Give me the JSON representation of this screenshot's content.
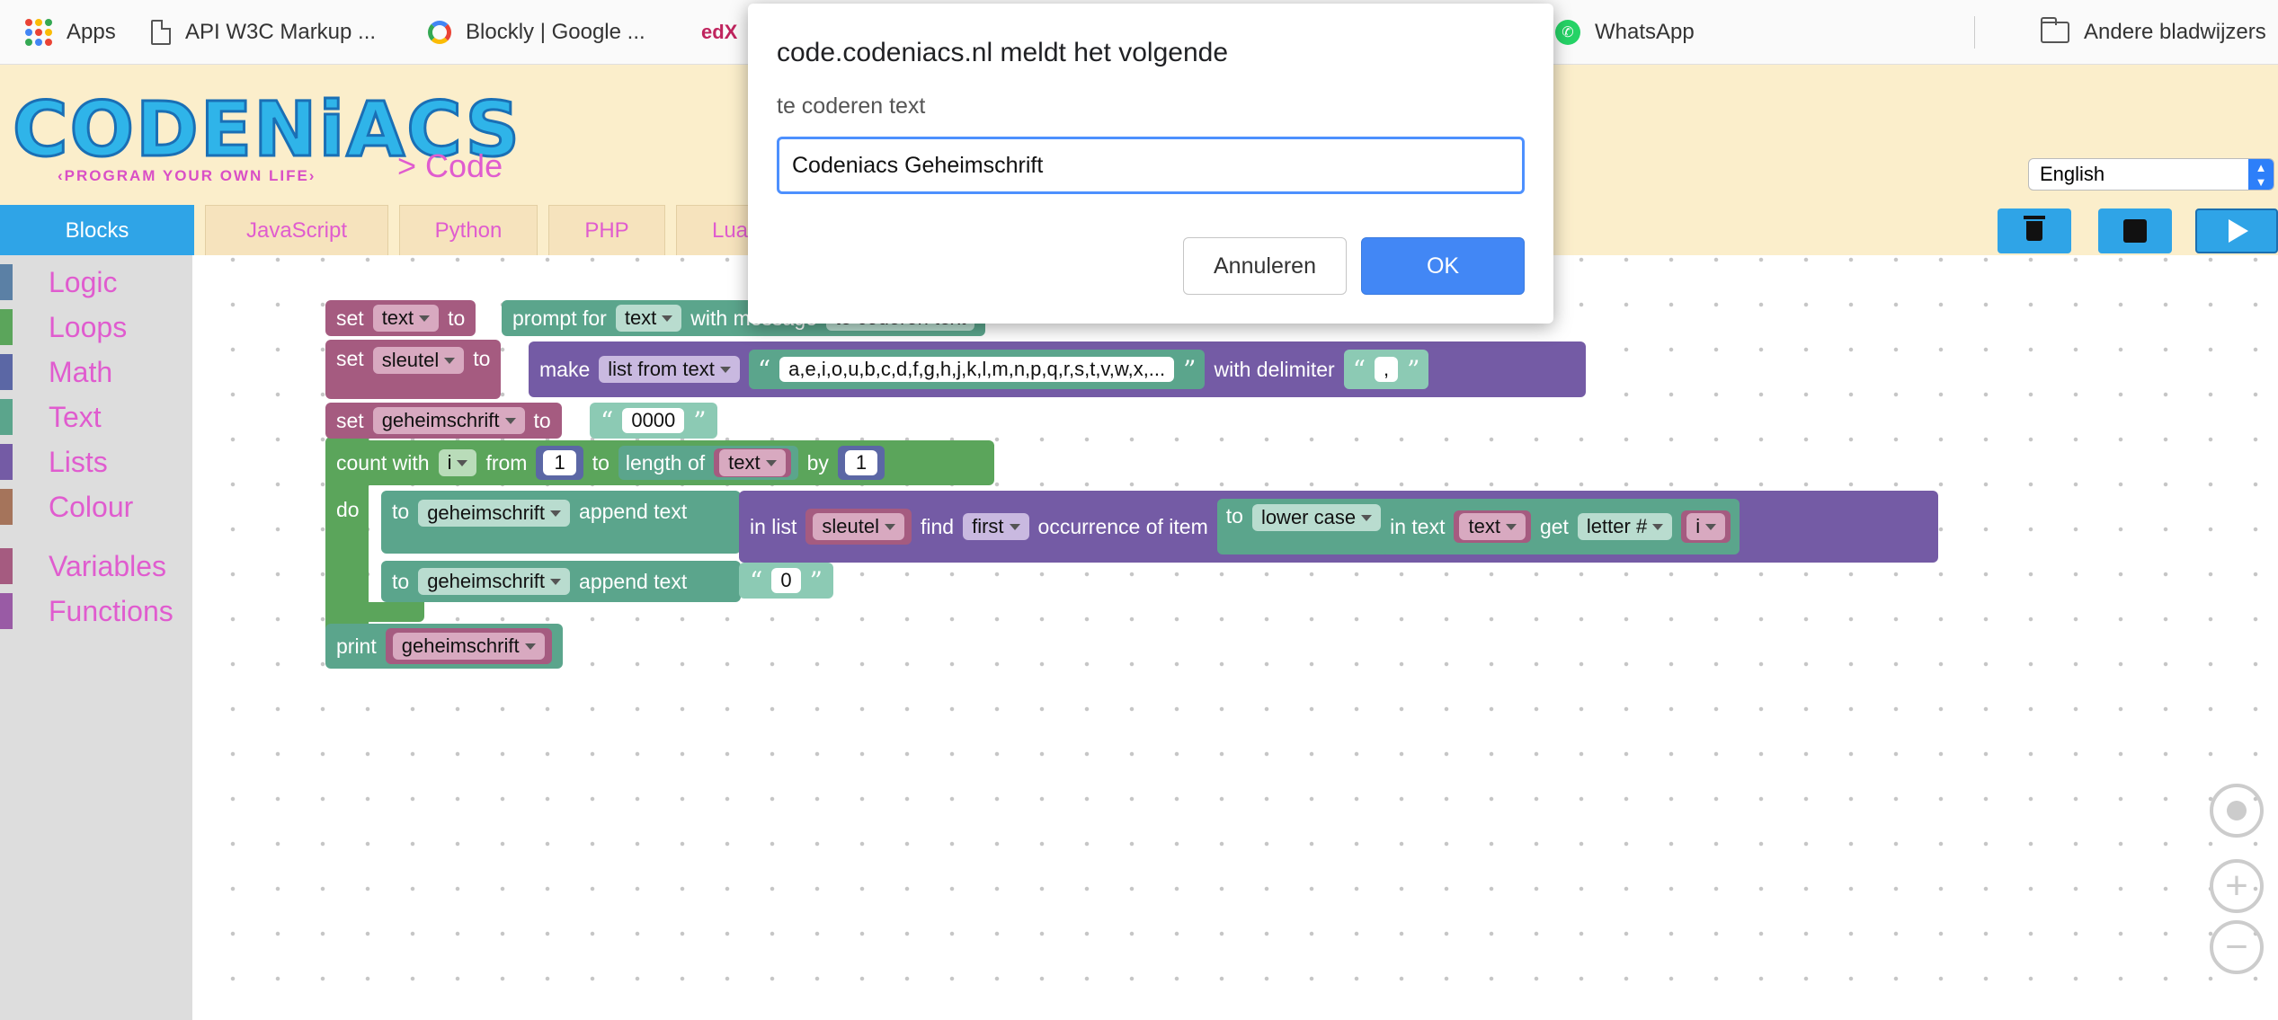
{
  "bookmarks": {
    "apps": "Apps",
    "api": "API W3C Markup ...",
    "blockly": "Blockly  |  Google ...",
    "edx": "edX",
    "whatsapp": "WhatsApp",
    "other": "Andere bladwijzers"
  },
  "header": {
    "logo": "CODENiACS",
    "logo_tagline": "‹PROGRAM YOUR OWN LIFE›",
    "breadcrumb": "> Code",
    "language": "English"
  },
  "tabs": [
    "Blocks",
    "JavaScript",
    "Python",
    "PHP",
    "Lua"
  ],
  "toolbar": {
    "delete": "trash-icon",
    "save": "save-icon",
    "run": "play-icon"
  },
  "toolbox": {
    "categories": [
      {
        "label": "Logic",
        "color": "#5b80a5"
      },
      {
        "label": "Loops",
        "color": "#5ba55b"
      },
      {
        "label": "Math",
        "color": "#5b67a5"
      },
      {
        "label": "Text",
        "color": "#5ba58c"
      },
      {
        "label": "Lists",
        "color": "#745ba5"
      },
      {
        "label": "Colour",
        "color": "#a5745b"
      },
      {
        "label": "Variables",
        "color": "#a55b80"
      },
      {
        "label": "Functions",
        "color": "#995ba5"
      }
    ]
  },
  "program": {
    "line1": {
      "set": "set",
      "var": "text",
      "to": "to",
      "prompt": "prompt for",
      "ptype": "text",
      "with": "with message",
      "msg": "te coderen text"
    },
    "line2": {
      "set": "set",
      "var": "sleutel",
      "to": "to",
      "make": "make",
      "mode": "list from text",
      "list": "a,e,i,o,u,b,c,d,f,g,h,j,k,l,m,n,p,q,r,s,t,v,w,x,...",
      "delim_label": "with delimiter",
      "delim": ","
    },
    "line3": {
      "set": "set",
      "var": "geheimschrift",
      "to": "to",
      "value": "0000"
    },
    "loop": {
      "count": "count with",
      "var": "i",
      "from": "from",
      "from_val": "1",
      "to": "to",
      "length": "length of",
      "length_var": "text",
      "by": "by",
      "by_val": "1",
      "do": "do"
    },
    "append1": {
      "to": "to",
      "var": "geheimschrift",
      "append": "append text",
      "inlist": "in list",
      "list_var": "sleutel",
      "find": "find",
      "which": "first",
      "occ": "occurrence of item",
      "to2": "to",
      "case": "lower case",
      "intext": "in text",
      "text_var": "text",
      "get": "get",
      "letter": "letter #",
      "idx": "i"
    },
    "append2": {
      "to": "to",
      "var": "geheimschrift",
      "append": "append text",
      "value": "0"
    },
    "print": {
      "label": "print",
      "var": "geheimschrift"
    }
  },
  "dialog": {
    "title": "code.codeniacs.nl meldt het volgende",
    "message": "te coderen text",
    "input_value": "Codeniacs Geheimschrift",
    "cancel": "Annuleren",
    "ok": "OK"
  }
}
